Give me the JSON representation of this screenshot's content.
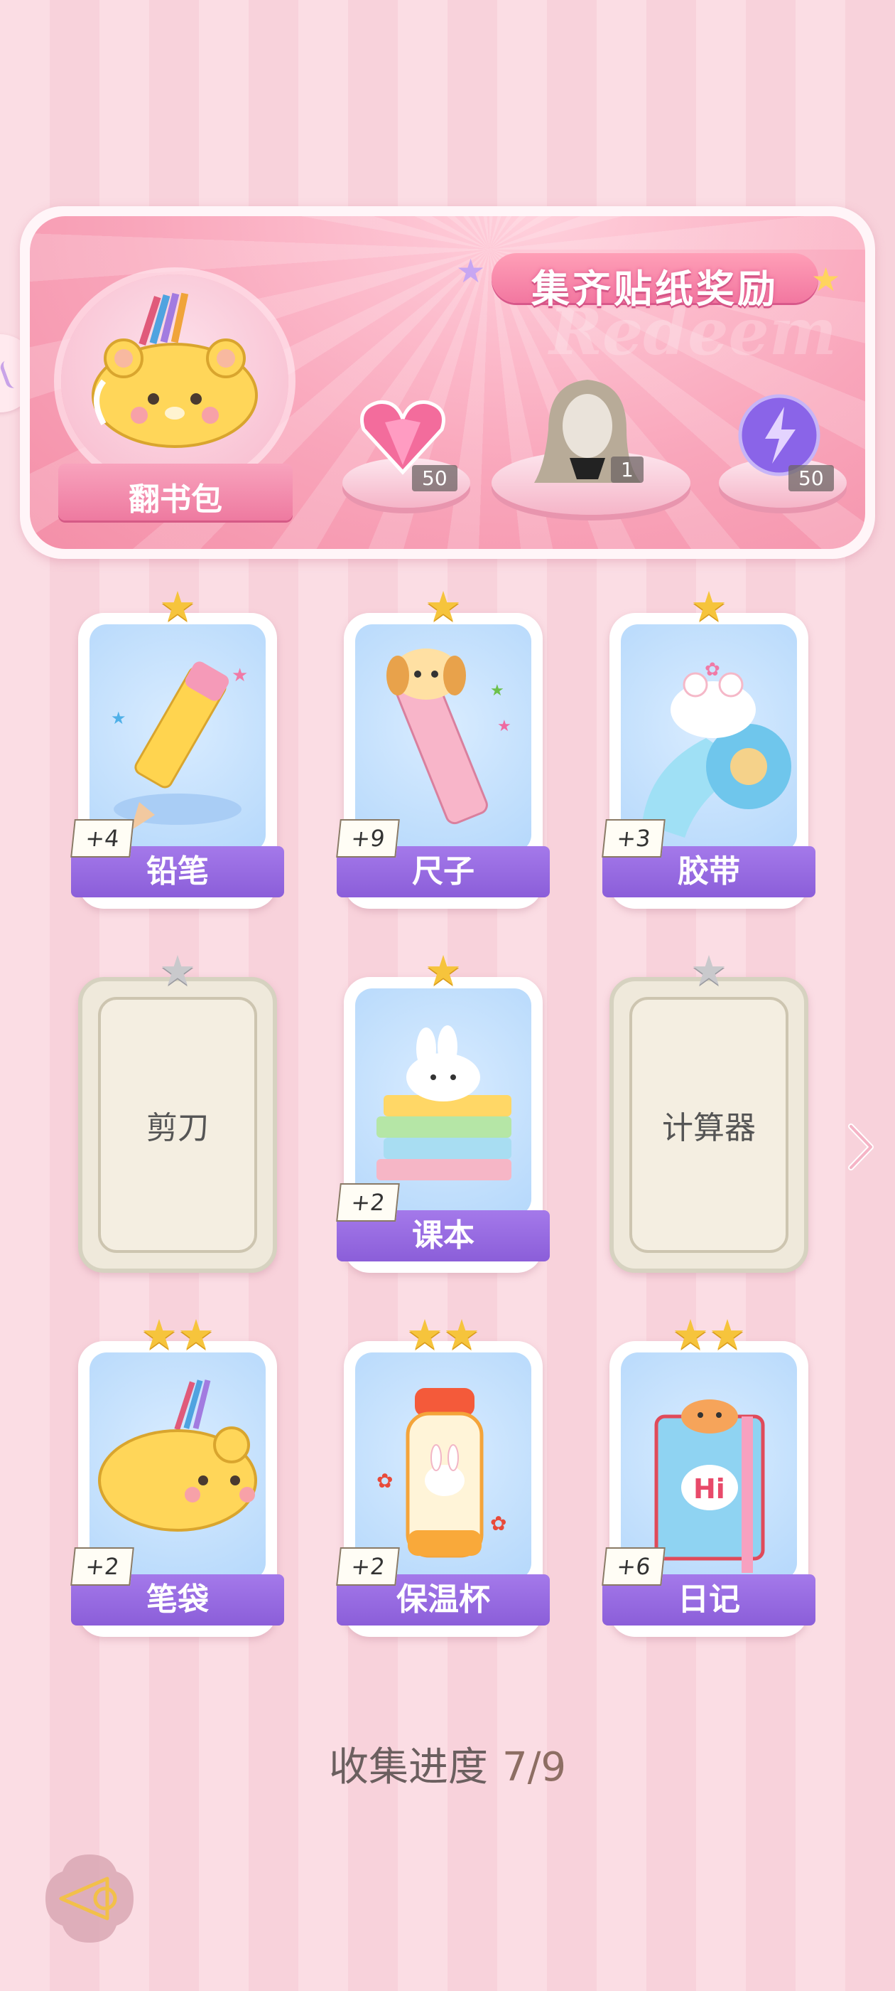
{
  "banner": {
    "title": "集齐贴纸奖励",
    "watermark": "Redeem",
    "bag_name": "翻书包",
    "rewards": [
      {
        "icon": "pink-heart-gem-icon",
        "count": "50"
      },
      {
        "icon": "hair-outfit-icon",
        "count": "1"
      },
      {
        "icon": "lightning-orb-icon",
        "count": "50"
      }
    ]
  },
  "cards": [
    {
      "name": "铅笔",
      "stars": 1,
      "bonus": "+4",
      "collected": true,
      "icon": "pencil-icon"
    },
    {
      "name": "尺子",
      "stars": 1,
      "bonus": "+9",
      "collected": true,
      "icon": "ruler-icon"
    },
    {
      "name": "胶带",
      "stars": 1,
      "bonus": "+3",
      "collected": true,
      "icon": "tape-icon"
    },
    {
      "name": "剪刀",
      "stars": 1,
      "bonus": "",
      "collected": false,
      "icon": "scissors-icon"
    },
    {
      "name": "课本",
      "stars": 1,
      "bonus": "+2",
      "collected": true,
      "icon": "textbook-icon"
    },
    {
      "name": "计算器",
      "stars": 1,
      "bonus": "",
      "collected": false,
      "icon": "calculator-icon"
    },
    {
      "name": "笔袋",
      "stars": 2,
      "bonus": "+2",
      "collected": true,
      "icon": "pencil-case-icon"
    },
    {
      "name": "保温杯",
      "stars": 2,
      "bonus": "+2",
      "collected": true,
      "icon": "thermos-icon"
    },
    {
      "name": "日记",
      "stars": 2,
      "bonus": "+6",
      "collected": true,
      "icon": "diary-icon"
    }
  ],
  "progress": {
    "label": "收集进度",
    "value": "7/9"
  },
  "colors": {
    "accent": "#8b5ed9",
    "pink": "#f48fa8",
    "star": "#f6c43c"
  }
}
